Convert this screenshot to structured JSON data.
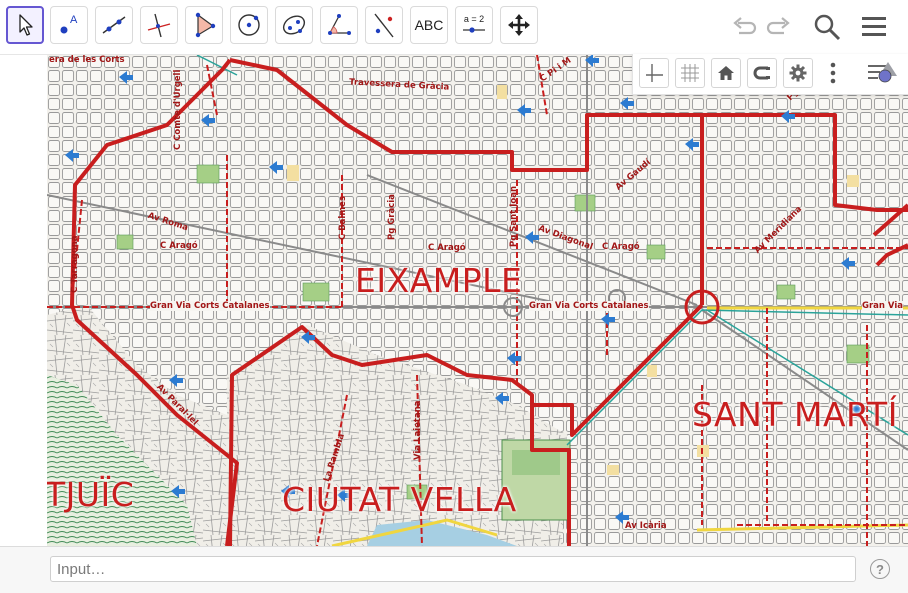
{
  "toolbar": {
    "tools": [
      {
        "name": "move-tool",
        "icon": "arrow-cursor-icon"
      },
      {
        "name": "point-tool",
        "icon": "point-icon",
        "label": "A"
      },
      {
        "name": "line-tool",
        "icon": "line-icon"
      },
      {
        "name": "perpendicular-line-tool",
        "icon": "perpendicular-icon"
      },
      {
        "name": "polygon-tool",
        "icon": "polygon-icon"
      },
      {
        "name": "circle-tool",
        "icon": "circle-icon"
      },
      {
        "name": "ellipse-tool",
        "icon": "ellipse-icon"
      },
      {
        "name": "angle-tool",
        "icon": "angle-icon"
      },
      {
        "name": "reflect-tool",
        "icon": "reflect-icon"
      },
      {
        "name": "text-tool",
        "icon": "text-icon",
        "label": "ABC"
      },
      {
        "name": "slider-tool",
        "icon": "slider-icon",
        "label": "a = 2"
      },
      {
        "name": "move-graphics-view-tool",
        "icon": "move-arrows-icon"
      }
    ],
    "undo_icon": "undo-icon",
    "redo_icon": "redo-icon",
    "search_icon": "search-icon",
    "menu_icon": "hamburger-menu-icon"
  },
  "stylebar": {
    "buttons": [
      "axes-icon",
      "grid-icon",
      "home-icon",
      "point-capturing-icon",
      "settings-icon",
      "more-vertical-icon"
    ],
    "toggle_icon": "stylebar-toggle-icon"
  },
  "map": {
    "districts": {
      "eixample": "EIXAMPLE",
      "sant_marti": "SANT MARTÍ",
      "ciutat_vella": "CIUTAT VELLA",
      "montjuic": "TJUÏC"
    },
    "streets": {
      "les_corts": "era de les Corts",
      "travessera": "Travessera de Gràcia",
      "pl_maragall": "C Pi i M",
      "comte_urgell": "C Comte d'Urgell",
      "roma": "Av Roma",
      "arago_1": "C Aragó",
      "tarragona": "C Tarragona",
      "balmes": "C Balmes",
      "pg_gracia": "Pg Gràcia",
      "arago_2": "C Aragó",
      "pg_sant_joan": "Pg Sant Joan",
      "diagonal": "Av Diagonal",
      "arago_3": "C Aragó",
      "gaudi": "Av Gaudí",
      "meridiana": "Av Meridiana",
      "gran_via_1": "Gran Via Corts Catalanes",
      "gran_via_2": "Gran Via Corts Catalanes",
      "gran_via_3": "Gran Via",
      "parallel": "Av Paral·lel",
      "la_rambla": "La Rambla",
      "via_laietana": "Via Laietana",
      "icaria": "Av Icària",
      "pg": "Pg"
    }
  },
  "input_bar": {
    "placeholder": "Input…",
    "help_label": "?"
  },
  "colors": {
    "accent": "#6557d2",
    "district_border": "#c81e1e",
    "marker": "#2c7bd1"
  }
}
